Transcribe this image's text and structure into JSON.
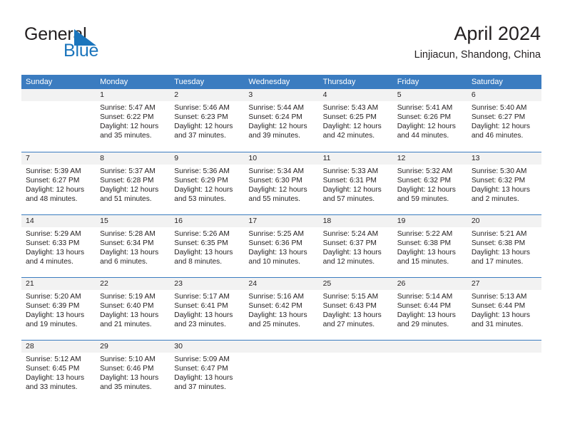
{
  "brand": {
    "word1": "General",
    "word2": "Blue",
    "triangle_color": "#1b75bc",
    "icon": "triangle-flag-icon"
  },
  "header": {
    "title": "April 2024",
    "subtitle": "Linjiacun, Shandong, China"
  },
  "theme": {
    "header_blue": "#3b7cc0",
    "day_band_gray": "#f2f2f2",
    "text": "#231f20"
  },
  "weekdays": [
    "Sunday",
    "Monday",
    "Tuesday",
    "Wednesday",
    "Thursday",
    "Friday",
    "Saturday"
  ],
  "weeks": [
    [
      {
        "num": "",
        "lines": []
      },
      {
        "num": "1",
        "lines": [
          "Sunrise: 5:47 AM",
          "Sunset: 6:22 PM",
          "Daylight: 12 hours",
          "and 35 minutes."
        ]
      },
      {
        "num": "2",
        "lines": [
          "Sunrise: 5:46 AM",
          "Sunset: 6:23 PM",
          "Daylight: 12 hours",
          "and 37 minutes."
        ]
      },
      {
        "num": "3",
        "lines": [
          "Sunrise: 5:44 AM",
          "Sunset: 6:24 PM",
          "Daylight: 12 hours",
          "and 39 minutes."
        ]
      },
      {
        "num": "4",
        "lines": [
          "Sunrise: 5:43 AM",
          "Sunset: 6:25 PM",
          "Daylight: 12 hours",
          "and 42 minutes."
        ]
      },
      {
        "num": "5",
        "lines": [
          "Sunrise: 5:41 AM",
          "Sunset: 6:26 PM",
          "Daylight: 12 hours",
          "and 44 minutes."
        ]
      },
      {
        "num": "6",
        "lines": [
          "Sunrise: 5:40 AM",
          "Sunset: 6:27 PM",
          "Daylight: 12 hours",
          "and 46 minutes."
        ]
      }
    ],
    [
      {
        "num": "7",
        "lines": [
          "Sunrise: 5:39 AM",
          "Sunset: 6:27 PM",
          "Daylight: 12 hours",
          "and 48 minutes."
        ]
      },
      {
        "num": "8",
        "lines": [
          "Sunrise: 5:37 AM",
          "Sunset: 6:28 PM",
          "Daylight: 12 hours",
          "and 51 minutes."
        ]
      },
      {
        "num": "9",
        "lines": [
          "Sunrise: 5:36 AM",
          "Sunset: 6:29 PM",
          "Daylight: 12 hours",
          "and 53 minutes."
        ]
      },
      {
        "num": "10",
        "lines": [
          "Sunrise: 5:34 AM",
          "Sunset: 6:30 PM",
          "Daylight: 12 hours",
          "and 55 minutes."
        ]
      },
      {
        "num": "11",
        "lines": [
          "Sunrise: 5:33 AM",
          "Sunset: 6:31 PM",
          "Daylight: 12 hours",
          "and 57 minutes."
        ]
      },
      {
        "num": "12",
        "lines": [
          "Sunrise: 5:32 AM",
          "Sunset: 6:32 PM",
          "Daylight: 12 hours",
          "and 59 minutes."
        ]
      },
      {
        "num": "13",
        "lines": [
          "Sunrise: 5:30 AM",
          "Sunset: 6:32 PM",
          "Daylight: 13 hours",
          "and 2 minutes."
        ]
      }
    ],
    [
      {
        "num": "14",
        "lines": [
          "Sunrise: 5:29 AM",
          "Sunset: 6:33 PM",
          "Daylight: 13 hours",
          "and 4 minutes."
        ]
      },
      {
        "num": "15",
        "lines": [
          "Sunrise: 5:28 AM",
          "Sunset: 6:34 PM",
          "Daylight: 13 hours",
          "and 6 minutes."
        ]
      },
      {
        "num": "16",
        "lines": [
          "Sunrise: 5:26 AM",
          "Sunset: 6:35 PM",
          "Daylight: 13 hours",
          "and 8 minutes."
        ]
      },
      {
        "num": "17",
        "lines": [
          "Sunrise: 5:25 AM",
          "Sunset: 6:36 PM",
          "Daylight: 13 hours",
          "and 10 minutes."
        ]
      },
      {
        "num": "18",
        "lines": [
          "Sunrise: 5:24 AM",
          "Sunset: 6:37 PM",
          "Daylight: 13 hours",
          "and 12 minutes."
        ]
      },
      {
        "num": "19",
        "lines": [
          "Sunrise: 5:22 AM",
          "Sunset: 6:38 PM",
          "Daylight: 13 hours",
          "and 15 minutes."
        ]
      },
      {
        "num": "20",
        "lines": [
          "Sunrise: 5:21 AM",
          "Sunset: 6:38 PM",
          "Daylight: 13 hours",
          "and 17 minutes."
        ]
      }
    ],
    [
      {
        "num": "21",
        "lines": [
          "Sunrise: 5:20 AM",
          "Sunset: 6:39 PM",
          "Daylight: 13 hours",
          "and 19 minutes."
        ]
      },
      {
        "num": "22",
        "lines": [
          "Sunrise: 5:19 AM",
          "Sunset: 6:40 PM",
          "Daylight: 13 hours",
          "and 21 minutes."
        ]
      },
      {
        "num": "23",
        "lines": [
          "Sunrise: 5:17 AM",
          "Sunset: 6:41 PM",
          "Daylight: 13 hours",
          "and 23 minutes."
        ]
      },
      {
        "num": "24",
        "lines": [
          "Sunrise: 5:16 AM",
          "Sunset: 6:42 PM",
          "Daylight: 13 hours",
          "and 25 minutes."
        ]
      },
      {
        "num": "25",
        "lines": [
          "Sunrise: 5:15 AM",
          "Sunset: 6:43 PM",
          "Daylight: 13 hours",
          "and 27 minutes."
        ]
      },
      {
        "num": "26",
        "lines": [
          "Sunrise: 5:14 AM",
          "Sunset: 6:44 PM",
          "Daylight: 13 hours",
          "and 29 minutes."
        ]
      },
      {
        "num": "27",
        "lines": [
          "Sunrise: 5:13 AM",
          "Sunset: 6:44 PM",
          "Daylight: 13 hours",
          "and 31 minutes."
        ]
      }
    ],
    [
      {
        "num": "28",
        "lines": [
          "Sunrise: 5:12 AM",
          "Sunset: 6:45 PM",
          "Daylight: 13 hours",
          "and 33 minutes."
        ]
      },
      {
        "num": "29",
        "lines": [
          "Sunrise: 5:10 AM",
          "Sunset: 6:46 PM",
          "Daylight: 13 hours",
          "and 35 minutes."
        ]
      },
      {
        "num": "30",
        "lines": [
          "Sunrise: 5:09 AM",
          "Sunset: 6:47 PM",
          "Daylight: 13 hours",
          "and 37 minutes."
        ]
      },
      {
        "num": "",
        "lines": []
      },
      {
        "num": "",
        "lines": []
      },
      {
        "num": "",
        "lines": []
      },
      {
        "num": "",
        "lines": []
      }
    ]
  ]
}
